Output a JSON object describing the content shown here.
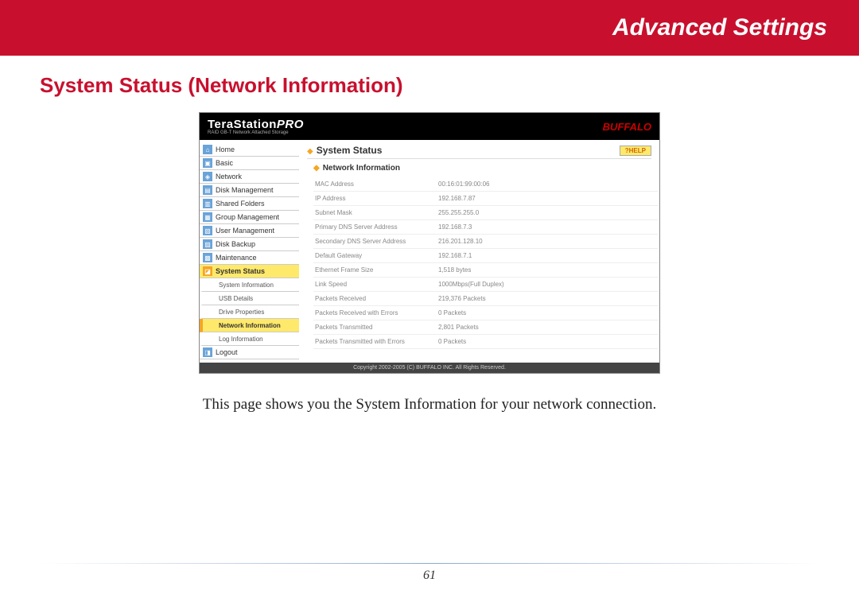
{
  "banner": {
    "title": "Advanced Settings"
  },
  "section": {
    "title": "System Status (Network Information)"
  },
  "screenshot": {
    "header": {
      "logo_main": "TeraStation",
      "logo_pro": "PRO",
      "logo_sub": "RAID GB-T Network Attached Storage",
      "brand": "BUFFALO"
    },
    "nav": {
      "items": [
        {
          "label": "Home"
        },
        {
          "label": "Basic"
        },
        {
          "label": "Network"
        },
        {
          "label": "Disk Management"
        },
        {
          "label": "Shared Folders"
        },
        {
          "label": "Group Management"
        },
        {
          "label": "User Management"
        },
        {
          "label": "Disk Backup"
        },
        {
          "label": "Maintenance"
        },
        {
          "label": "System Status",
          "active": true
        }
      ],
      "subitems": [
        {
          "label": "System Information"
        },
        {
          "label": "USB Details"
        },
        {
          "label": "Drive Properties"
        },
        {
          "label": "Network Information",
          "active": true
        },
        {
          "label": "Log Information"
        }
      ],
      "logout": "Logout"
    },
    "content": {
      "title": "System Status",
      "help": "?HELP",
      "subtitle": "Network Information",
      "rows": [
        {
          "label": "MAC Address",
          "value": "00:16:01:99:00:06"
        },
        {
          "label": "IP Address",
          "value": "192.168.7.87"
        },
        {
          "label": "Subnet Mask",
          "value": "255.255.255.0"
        },
        {
          "label": "Primary DNS Server Address",
          "value": "192.168.7.3"
        },
        {
          "label": "Secondary DNS Server Address",
          "value": "216.201.128.10"
        },
        {
          "label": "Default Gateway",
          "value": "192.168.7.1"
        },
        {
          "label": "Ethernet Frame Size",
          "value": "1,518 bytes"
        },
        {
          "label": "Link Speed",
          "value": "1000Mbps(Full Duplex)"
        },
        {
          "label": "Packets Received",
          "value": "219,376 Packets"
        },
        {
          "label": "Packets Received with Errors",
          "value": "0 Packets"
        },
        {
          "label": "Packets Transmitted",
          "value": "2,801 Packets"
        },
        {
          "label": "Packets Transmitted with Errors",
          "value": "0 Packets"
        }
      ]
    },
    "footer": "Copyright 2002-2005 (C) BUFFALO INC. All Rights Reserved."
  },
  "caption": "This page shows you the System Information for your network connection.",
  "page_number": "61"
}
